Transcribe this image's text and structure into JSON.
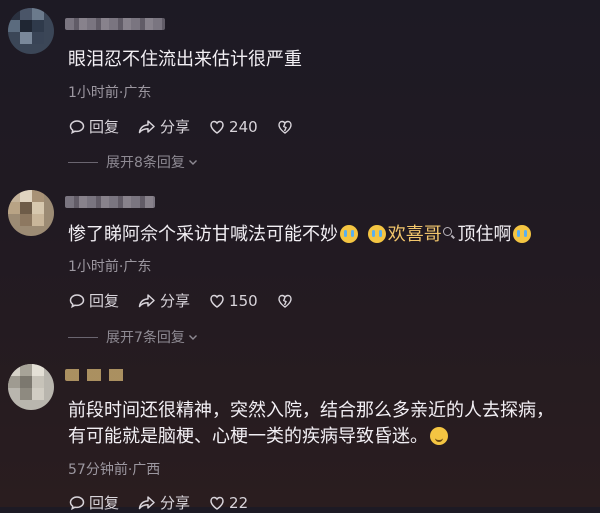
{
  "comments": [
    {
      "text": "眼泪忍不住流出来估计很严重",
      "meta": "1小时前·广东",
      "reply_label": "回复",
      "share_label": "分享",
      "likes": "240",
      "expand_label": "展开8条回复"
    },
    {
      "text_before": "惨了睇阿佘个采访甘喊法可能不妙",
      "mention": "欢喜哥",
      "text_after": "顶住啊",
      "meta": "1小时前·广东",
      "reply_label": "回复",
      "share_label": "分享",
      "likes": "150",
      "expand_label": "展开7条回复"
    },
    {
      "text_line1": "前段时间还很精神，突然入院，结合那么多亲近的人去探病，",
      "text_line2": "有可能就是脑梗、心梗一类的疾病导致昏迷。",
      "meta": "57分钟前·广西",
      "reply_label": "回复",
      "share_label": "分享",
      "likes": "22"
    }
  ],
  "icons": {
    "reply": "speech-bubble-icon",
    "share": "share-arrow-icon",
    "like": "heart-icon",
    "dislike": "broken-heart-icon",
    "expand": "chevron-down-icon",
    "cry_emoji": "crying-face-emoji",
    "smile_emoji": "smiling-face-emoji"
  }
}
